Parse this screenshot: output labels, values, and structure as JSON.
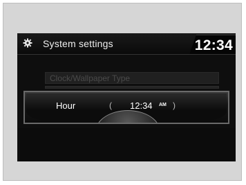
{
  "header": {
    "icon": "gear-icon",
    "title": "System settings",
    "clock": "12:34"
  },
  "list": {
    "faded_item_label": "Clock/Wallpaper Type"
  },
  "popup": {
    "label": "Hour",
    "value": "12:34",
    "meridiem": "AM",
    "left_arrow": "(",
    "right_arrow": ")"
  },
  "colors": {
    "screen_bg": "#0e0e0e",
    "popup_border": "#6a6a6a",
    "text": "#ffffff"
  }
}
